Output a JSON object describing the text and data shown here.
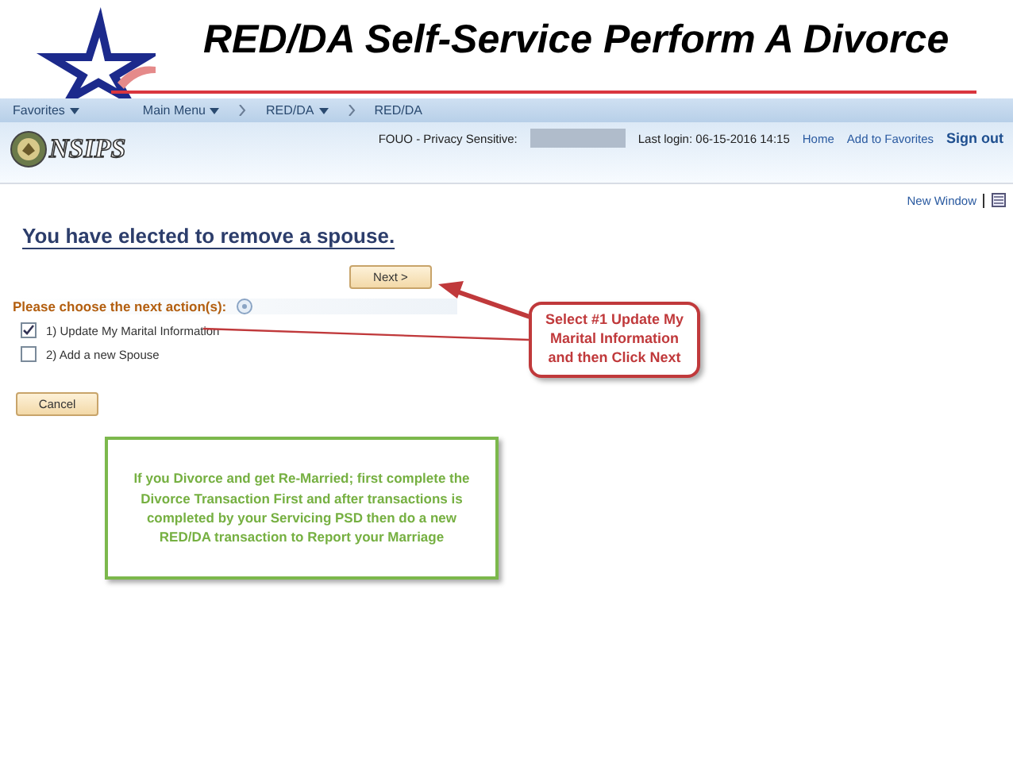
{
  "slide": {
    "title": "RED/DA Self-Service Perform A Divorce"
  },
  "nav": {
    "items": [
      {
        "label": "Favorites",
        "dropdown": true
      },
      {
        "label": "Main Menu",
        "dropdown": true
      },
      {
        "label": "RED/DA",
        "dropdown": true
      },
      {
        "label": "RED/DA",
        "dropdown": false
      }
    ]
  },
  "header": {
    "logo": "NSIPS",
    "privacy_label": "FOUO - Privacy Sensitive:",
    "last_login": "Last login: 06-15-2016 14:15",
    "links": [
      "Home",
      "Add to Favorites"
    ],
    "sign_out": "Sign out"
  },
  "toolbar": {
    "new_window": "New Window"
  },
  "page": {
    "heading": "You have elected to remove a spouse.",
    "next_button": "Next >",
    "section_label": "Please choose the next action(s):",
    "options": [
      {
        "label": "1) Update My Marital Information",
        "checked": true
      },
      {
        "label": "2) Add a new Spouse",
        "checked": false
      }
    ],
    "cancel_button": "Cancel"
  },
  "callouts": [
    {
      "kind": "red",
      "text": "Select #1 Update My Marital Information and then Click Next"
    },
    {
      "kind": "green",
      "text": "If you Divorce and get Re-Married; first complete the Divorce Transaction First and after transactions is completed by your Servicing PSD then do a new RED/DA transaction to Report your Marriage"
    }
  ]
}
